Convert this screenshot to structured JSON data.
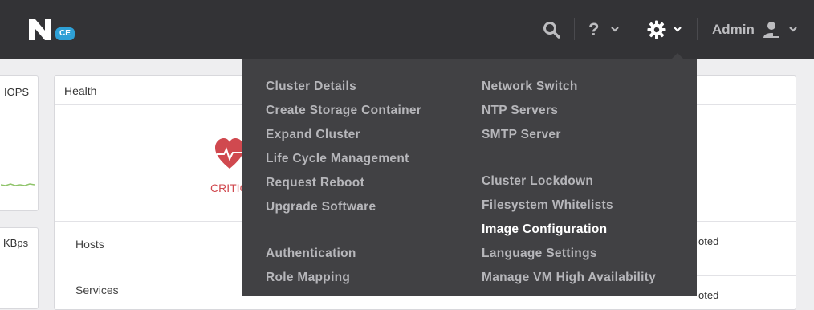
{
  "header": {
    "logo_badge": "CE",
    "help_label": "?",
    "user_label": "Admin"
  },
  "background": {
    "iops_label": "IOPS",
    "kbps_label": "KBps",
    "health_title": "Health",
    "health_status": "CRITIC",
    "rows": [
      "Hosts",
      "Services"
    ],
    "right_texts": [
      "oted",
      "oted"
    ]
  },
  "settings_menu": {
    "left_column": [
      "Cluster Details",
      "Create Storage Container",
      "Expand Cluster",
      "Life Cycle Management",
      "Request Reboot",
      "Upgrade Software",
      "Authentication",
      "Role Mapping"
    ],
    "right_column": [
      "Network Switch",
      "NTP Servers",
      "SMTP Server",
      "Cluster Lockdown",
      "Filesystem Whitelists",
      "Image Configuration",
      "Language Settings",
      "Manage VM High Availability"
    ],
    "highlighted": "Image Configuration"
  },
  "colors": {
    "topbar": "#333336",
    "menu_bg": "#414144",
    "menu_text": "#b6b6ba",
    "critical": "#d0494f",
    "accent": "#2ea0d6"
  }
}
